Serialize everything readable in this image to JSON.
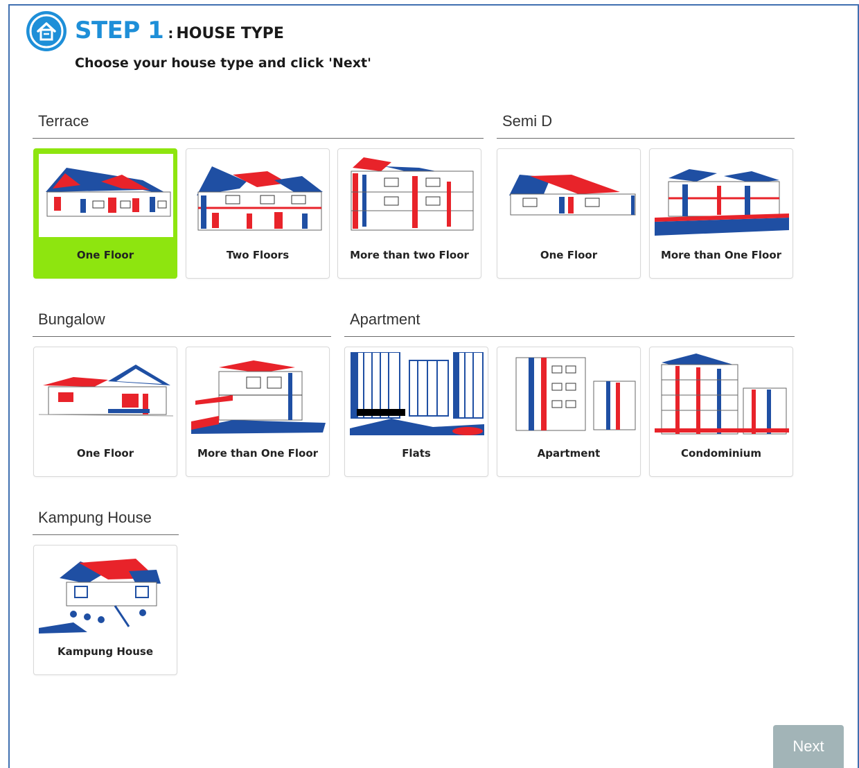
{
  "header": {
    "step": "STEP 1",
    "separator": ":",
    "subtitle": "HOUSE TYPE",
    "instruction": "Choose your house type and click 'Next'",
    "logo_icon": "house-icon"
  },
  "sections": {
    "terrace": {
      "title": "Terrace",
      "items": [
        {
          "label": "One Floor",
          "icon": "terrace-one-floor-illustration",
          "selected": true
        },
        {
          "label": "Two Floors",
          "icon": "terrace-two-floors-illustration"
        },
        {
          "label": "More than two Floor",
          "icon": "terrace-multi-floor-illustration"
        }
      ]
    },
    "semi_d": {
      "title": "Semi D",
      "items": [
        {
          "label": "One Floor",
          "icon": "semi-d-one-floor-illustration"
        },
        {
          "label": "More than One Floor",
          "icon": "semi-d-multi-floor-illustration"
        }
      ]
    },
    "bungalow": {
      "title": "Bungalow",
      "items": [
        {
          "label": "One Floor",
          "icon": "bungalow-one-floor-illustration"
        },
        {
          "label": "More than One Floor",
          "icon": "bungalow-multi-floor-illustration"
        }
      ]
    },
    "apartment": {
      "title": "Apartment",
      "items": [
        {
          "label": "Flats",
          "icon": "flats-illustration"
        },
        {
          "label": "Apartment",
          "icon": "apartment-illustration"
        },
        {
          "label": "Condominium",
          "icon": "condominium-illustration"
        }
      ]
    },
    "kampung": {
      "title": "Kampung House",
      "items": [
        {
          "label": "Kampung House",
          "icon": "kampung-house-illustration"
        }
      ]
    }
  },
  "footer": {
    "next_label": "Next"
  },
  "colors": {
    "accent_blue": "#1e8fd8",
    "selected_green": "#8ee50f",
    "illustration_red": "#e8232a",
    "illustration_blue": "#1f4fa3",
    "next_disabled": "#a2b4b7"
  }
}
